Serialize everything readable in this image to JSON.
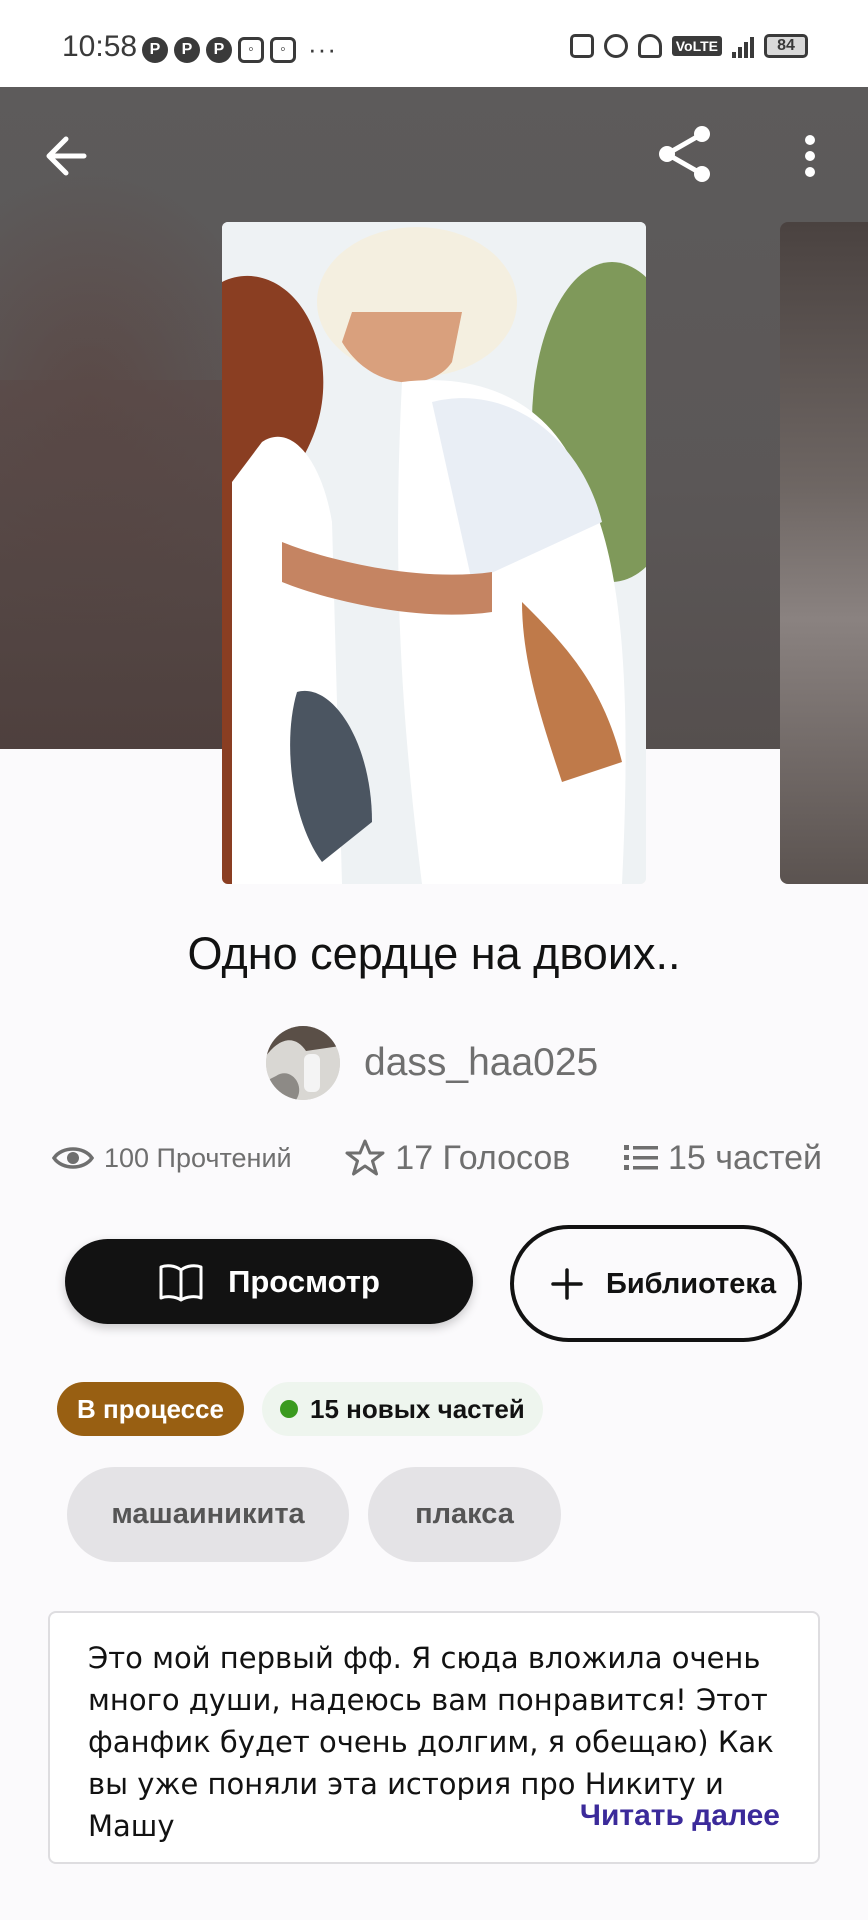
{
  "status_bar": {
    "time": "10:58",
    "more": "···",
    "battery": "84",
    "volte": "VoLTE"
  },
  "header": {
    "back_icon": "arrow-left-icon",
    "share_icon": "share-icon",
    "more_icon": "more-vertical-icon"
  },
  "story": {
    "title": "Одно сердце на двоих..",
    "author": "dass_haa025",
    "stats": {
      "reads": "100 Прочтений",
      "votes": "17 Голосов",
      "parts": "15 частей"
    },
    "actions": {
      "read_label": "Просмотр",
      "library_label": "Библиотека"
    },
    "badges": {
      "status": "В процессе",
      "new_parts": "15 новых частей"
    },
    "tags": [
      "машаиникита",
      "плакса"
    ],
    "description": "Это мой первый фф. Я сюда вложила очень много души, надеюсь вам понравится! Этот фанфик будет очень долгим, я обещаю) Как вы уже поняли эта история про Никиту и Машу",
    "read_more": "Читать далее"
  },
  "colors": {
    "status_badge": "#985f12",
    "read_more": "#3b2a9a",
    "new_dot": "#3a9a1f",
    "primary_button": "#121212"
  }
}
